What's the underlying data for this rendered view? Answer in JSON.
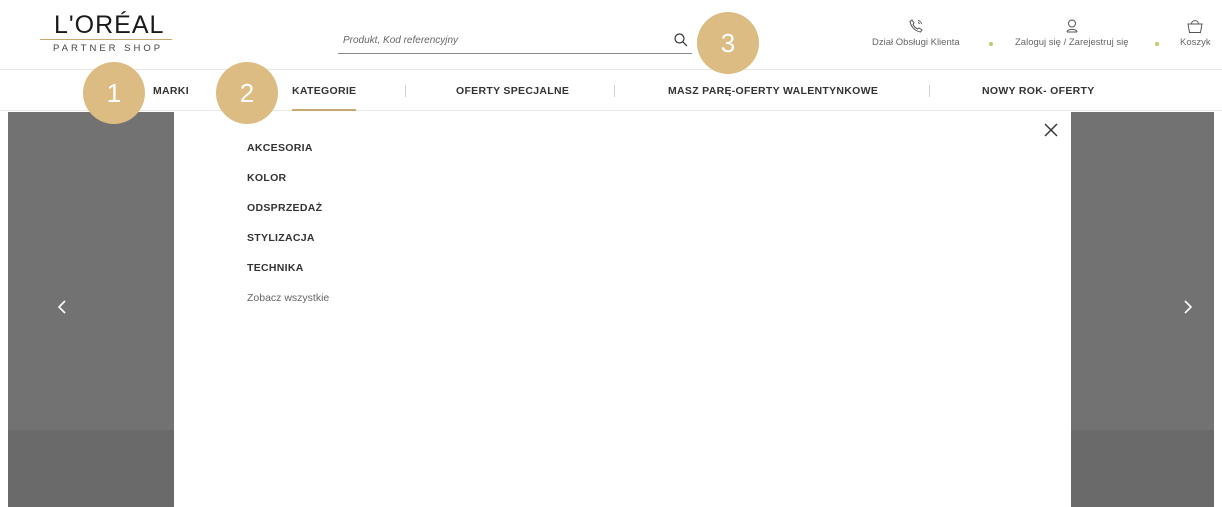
{
  "brand": {
    "name": "L'ORÉAL",
    "sub": "PARTNER SHOP"
  },
  "search": {
    "placeholder": "Produkt, Kod referencyjny"
  },
  "utilities": {
    "customer_service": "Dział Obsługi Klienta",
    "login": "Zaloguj się / Zarejestruj się",
    "cart": "Koszyk"
  },
  "nav": {
    "items": [
      {
        "label": "MARKI"
      },
      {
        "label": "KATEGORIE"
      },
      {
        "label": "OFERTY SPECJALNE"
      },
      {
        "label": "MASZ PARĘ-OFERTY WALENTYNKOWE"
      },
      {
        "label": "NOWY ROK- OFERTY"
      }
    ],
    "active": "KATEGORIE"
  },
  "dropdown": {
    "categories": [
      {
        "label": "AKCESORIA"
      },
      {
        "label": "KOLOR"
      },
      {
        "label": "ODSPRZEDAŻ"
      },
      {
        "label": "STYLIZACJA"
      },
      {
        "label": "TECHNIKA"
      }
    ],
    "see_all": "Zobacz wszystkie"
  },
  "markers": [
    "1",
    "2",
    "3"
  ],
  "colors": {
    "accent": "#c9a96e",
    "marker": "#dcbc82",
    "dot": "#b9cf6b",
    "backdrop": "#727272"
  }
}
